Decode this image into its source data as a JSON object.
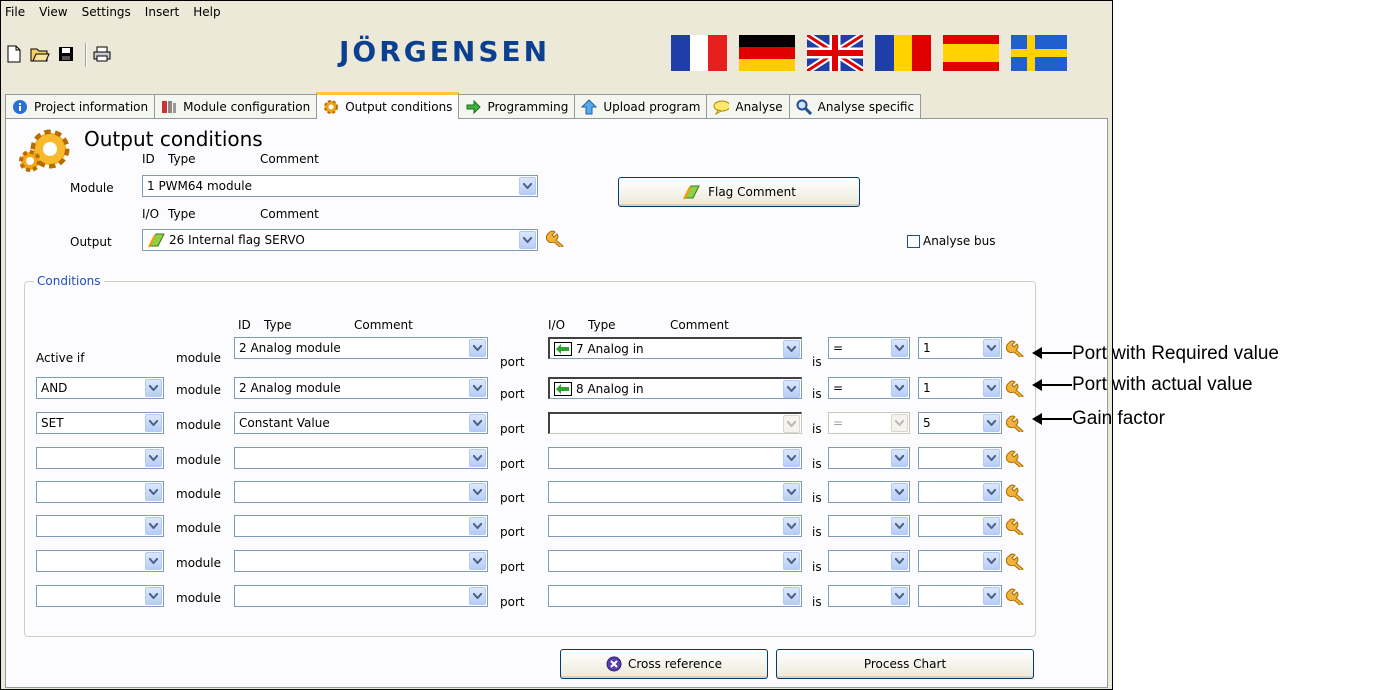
{
  "menu": [
    "File",
    "View",
    "Settings",
    "Insert",
    "Help"
  ],
  "logo_text": "JÖRGENSEN",
  "toolbar_icons": [
    "new-file-icon",
    "open-folder-icon",
    "save-icon",
    "print-icon"
  ],
  "flags": [
    "France",
    "Germany",
    "United Kingdom",
    "Romania",
    "Spain",
    "Sweden"
  ],
  "tabs": [
    {
      "label": "Project information",
      "icon": "info-icon"
    },
    {
      "label": "Module configuration",
      "icon": "module-icon"
    },
    {
      "label": "Output conditions",
      "icon": "gear-icon",
      "active": true
    },
    {
      "label": "Programming",
      "icon": "green-arrow-icon"
    },
    {
      "label": "Upload program",
      "icon": "upload-arrow-icon"
    },
    {
      "label": "Analyse",
      "icon": "speech-bubble-icon"
    },
    {
      "label": "Analyse specific",
      "icon": "magnifier-icon"
    }
  ],
  "page": {
    "title": "Output conditions",
    "module_header": {
      "id": "ID",
      "type": "Type",
      "comment": "Comment"
    },
    "module_label": "Module",
    "module_value": "1 PWM64 module",
    "output_header": {
      "io": "I/O",
      "type": "Type",
      "comment": "Comment"
    },
    "output_label": "Output",
    "output_value": "26 Internal flag SERVO",
    "flag_comment_button": "Flag Comment",
    "analyse_bus_label": "Analyse bus",
    "analyse_bus_checked": false
  },
  "conditions": {
    "group_title": "Conditions",
    "header_left": {
      "id": "ID",
      "type": "Type",
      "comment": "Comment"
    },
    "header_right": {
      "io": "I/O",
      "type": "Type",
      "comment": "Comment"
    },
    "module_word": "module",
    "port_word": "port",
    "is_word": "is",
    "rows": [
      {
        "logic": "Active if",
        "logic_is_text": true,
        "module": "2 Analog module",
        "port": "7 Analog in",
        "op": "=",
        "value": "1",
        "port_disabled": false
      },
      {
        "logic": "AND",
        "logic_is_text": false,
        "module": "2 Analog module",
        "port": "8 Analog in",
        "op": "=",
        "value": "1",
        "port_disabled": false
      },
      {
        "logic": "SET",
        "logic_is_text": false,
        "module": "Constant Value",
        "port": "",
        "op": "=",
        "value": "5",
        "port_disabled": true
      },
      {
        "logic": "",
        "logic_is_text": false,
        "module": "",
        "port": "",
        "op": "",
        "value": "",
        "port_disabled": false
      },
      {
        "logic": "",
        "logic_is_text": false,
        "module": "",
        "port": "",
        "op": "",
        "value": "",
        "port_disabled": false
      },
      {
        "logic": "",
        "logic_is_text": false,
        "module": "",
        "port": "",
        "op": "",
        "value": "",
        "port_disabled": false
      },
      {
        "logic": "",
        "logic_is_text": false,
        "module": "",
        "port": "",
        "op": "",
        "value": "",
        "port_disabled": false
      },
      {
        "logic": "",
        "logic_is_text": false,
        "module": "",
        "port": "",
        "op": "",
        "value": "",
        "port_disabled": false
      }
    ]
  },
  "buttons": {
    "cross_reference": "Cross reference",
    "process_chart": "Process Chart"
  },
  "annotations": [
    "Port with Required value",
    "Port with actual value",
    "Gain factor"
  ],
  "colors": {
    "window_bg": "#ece9d8",
    "panel_bg": "#fcfcfe",
    "active_tab_accent": "#ffc83c",
    "group_title": "#1f4fc6",
    "logo": "#0b3f8f"
  }
}
